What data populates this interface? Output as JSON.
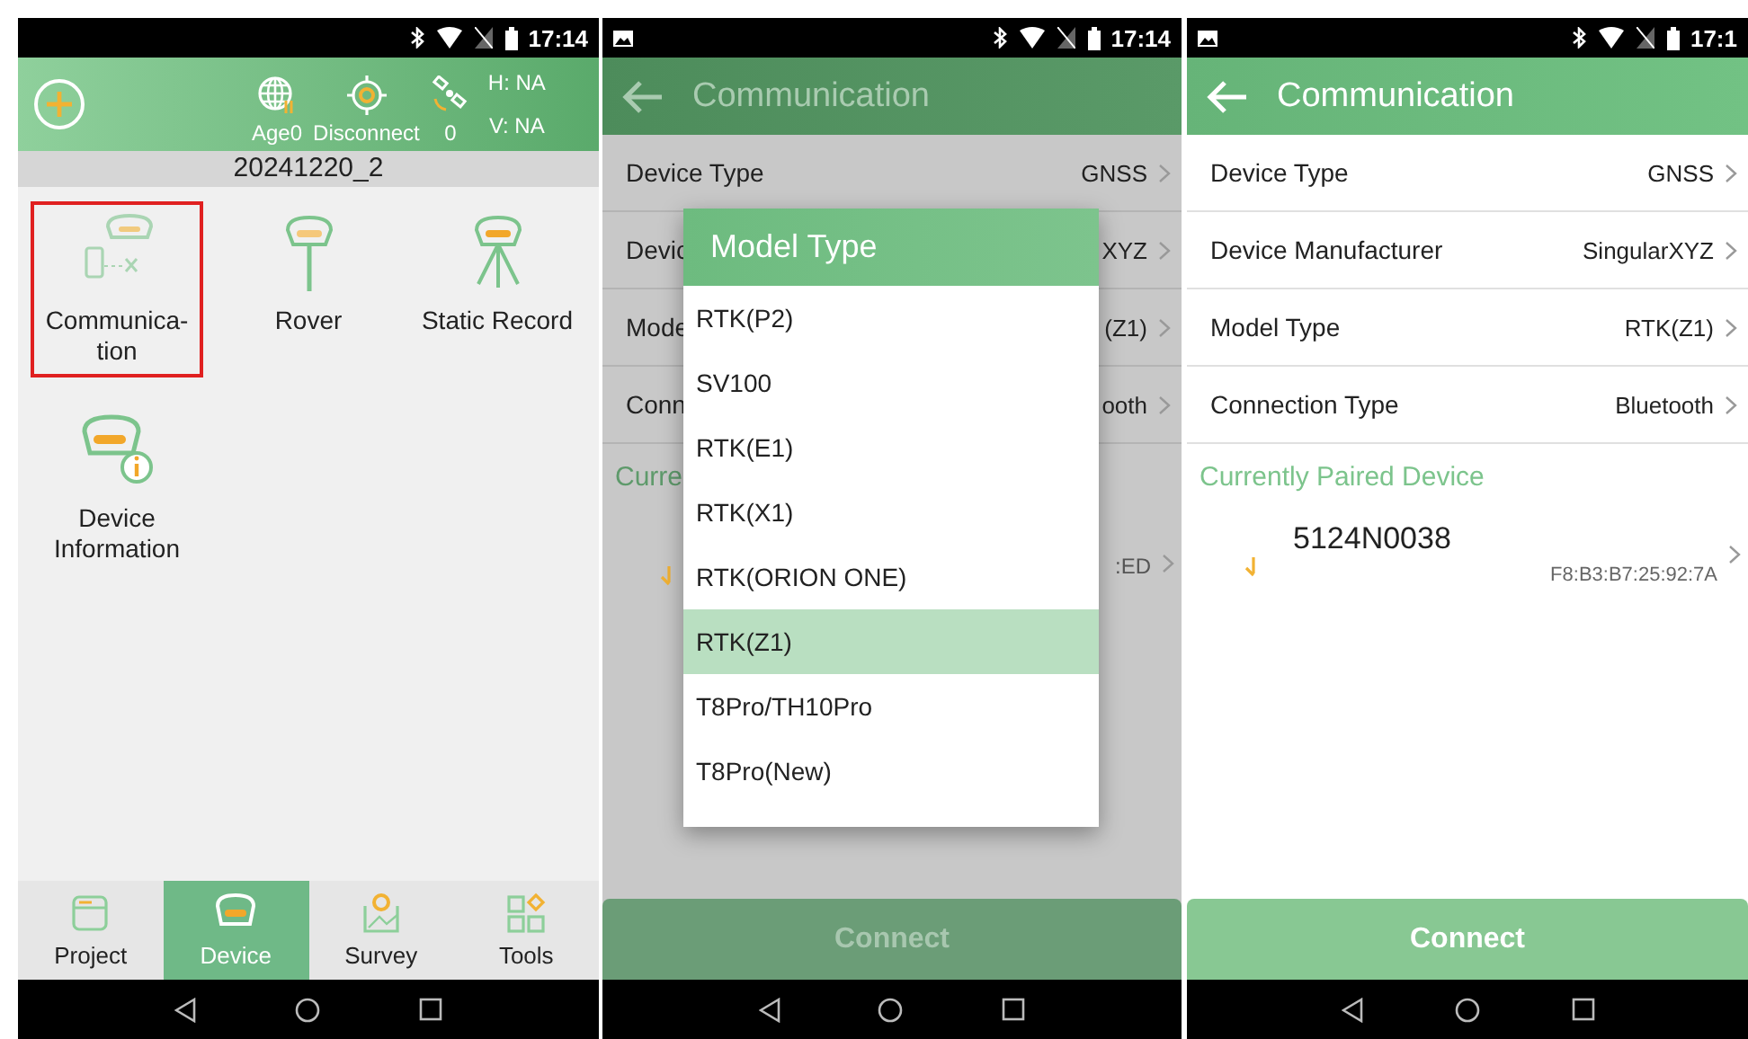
{
  "home_screen": {
    "status_bar": {
      "time": "17:14"
    },
    "header": {
      "age": "Age0",
      "link_status": "Disconnect",
      "satellites": "0",
      "h_precision": "H: NA",
      "v_precision": "V: NA"
    },
    "project_name": "20241220_2",
    "tiles": [
      {
        "kind": "communication",
        "label": "Communica-\ntion",
        "highlighted": true
      },
      {
        "kind": "rover",
        "label": "Rover",
        "highlighted": false
      },
      {
        "kind": "static",
        "label": "Static Record",
        "highlighted": false
      },
      {
        "kind": "info",
        "label": "Device Information",
        "highlighted": false
      }
    ],
    "bottom_tabs": [
      {
        "kind": "project",
        "label": "Project",
        "selected": false
      },
      {
        "kind": "device",
        "label": "Device",
        "selected": true
      },
      {
        "kind": "survey",
        "label": "Survey",
        "selected": false
      },
      {
        "kind": "tools",
        "label": "Tools",
        "selected": false
      }
    ]
  },
  "model_picker_screen": {
    "status_bar": {
      "time": "17:14"
    },
    "dimmed": true,
    "title": "Communication",
    "settings": [
      {
        "label": "Device Type",
        "value": "GNSS"
      },
      {
        "label": "Devic",
        "value": "XYZ"
      },
      {
        "label": "Mode",
        "value": "(Z1)"
      },
      {
        "label": "Conn",
        "value": "ooth"
      }
    ],
    "section_title": "Curre",
    "paired_device": {
      "address": ":ED"
    },
    "connect_button": "Connect",
    "dialog": {
      "title": "Model Type",
      "options": [
        {
          "label": "RTK(P2)",
          "selected": false
        },
        {
          "label": "SV100",
          "selected": false
        },
        {
          "label": "RTK(E1)",
          "selected": false
        },
        {
          "label": "RTK(X1)",
          "selected": false
        },
        {
          "label": "RTK(ORION ONE)",
          "selected": false
        },
        {
          "label": "RTK(Z1)",
          "selected": true
        },
        {
          "label": "T8Pro/TH10Pro",
          "selected": false
        },
        {
          "label": "T8Pro(New)",
          "selected": false
        }
      ]
    }
  },
  "communication_screen": {
    "status_bar": {
      "time": "17:1"
    },
    "dimmed": false,
    "title": "Communication",
    "settings": [
      {
        "label": "Device Type",
        "value": "GNSS"
      },
      {
        "label": "Device Manufacturer",
        "value": "SingularXYZ"
      },
      {
        "label": "Model Type",
        "value": "RTK(Z1)"
      },
      {
        "label": "Connection Type",
        "value": "Bluetooth"
      }
    ],
    "section_title": "Currently Paired Device",
    "paired_device": {
      "name": "5124N0038",
      "address": "F8:B3:B7:25:92:7A"
    },
    "connect_button": "Connect"
  }
}
